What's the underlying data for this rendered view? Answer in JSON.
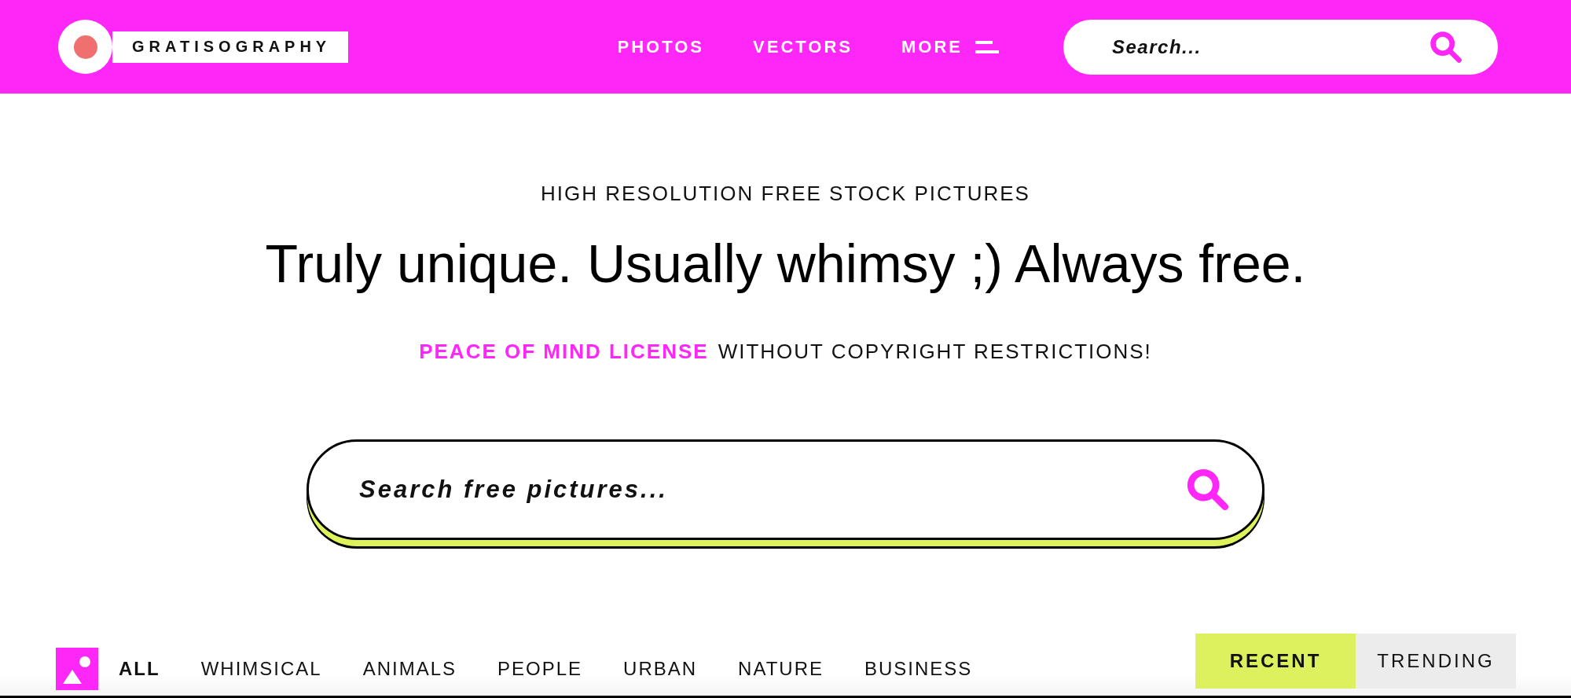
{
  "header": {
    "logo": "GRATISOGRAPHY",
    "nav": [
      {
        "label": "PHOTOS",
        "kind": "link"
      },
      {
        "label": "VECTORS",
        "kind": "link"
      },
      {
        "label": "MORE",
        "kind": "menu"
      }
    ],
    "search": {
      "placeholder": "Search..."
    }
  },
  "hero": {
    "kicker": "HIGH RESOLUTION FREE STOCK PICTURES",
    "headline": "Truly unique. Usually whimsy ;) Always free.",
    "license_link": "PEACE OF MIND LICENSE",
    "license_text": "WITHOUT COPYRIGHT RESTRICTIONS!",
    "search": {
      "placeholder": "Search free pictures..."
    }
  },
  "categories": [
    {
      "label": "ALL",
      "selected": true
    },
    {
      "label": "WHIMSICAL",
      "selected": false
    },
    {
      "label": "ANIMALS",
      "selected": false
    },
    {
      "label": "PEOPLE",
      "selected": false
    },
    {
      "label": "URBAN",
      "selected": false
    },
    {
      "label": "NATURE",
      "selected": false
    },
    {
      "label": "BUSINESS",
      "selected": false
    }
  ],
  "sort_tabs": [
    {
      "label": "RECENT",
      "selected": true
    },
    {
      "label": "TRENDING",
      "selected": false
    }
  ]
}
